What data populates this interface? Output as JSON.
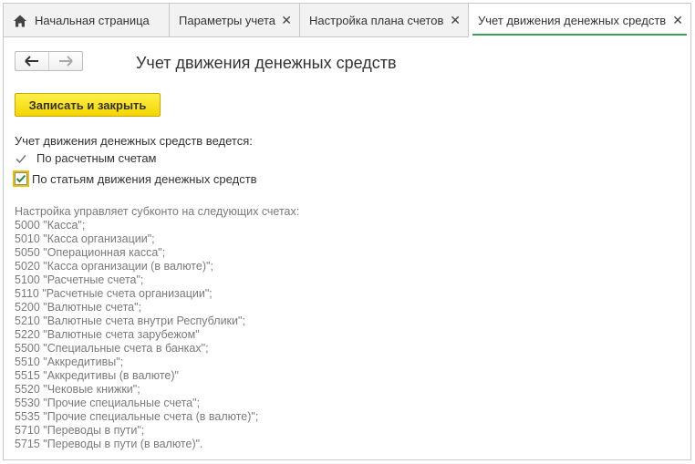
{
  "tabs": {
    "home": "Начальная страница",
    "params": "Параметры учета",
    "plan": "Настройка плана счетов",
    "cash": "Учет движения денежных средств"
  },
  "form": {
    "title": "Учет движения денежных средств",
    "save_label": "Записать и закрыть",
    "intro": "Учет движения денежных средств ведется:",
    "by_accounts": "По расчетным счетам",
    "by_items": "По статьям движения денежных средств",
    "by_items_checked": true
  },
  "accounts": {
    "header": "Настройка управляет субконто на следующих счетах:",
    "lines": [
      "5000 \"Касса\";",
      "5010 \"Касса организации\";",
      "5050 \"Операционная касса\";",
      "5020 \"Касса организации (в валюте)\";",
      "5100 \"Расчетные счета\";",
      "5110 \"Расчетные счета организации\";",
      "5200 \"Валютные счета\";",
      "5210 \"Валютные счета внутри Республики\";",
      "5220 \"Валютные счета зарубежом\"",
      "5500 \"Специальные счета в банках\";",
      "5510 \"Аккредитивы\";",
      "5515 \"Аккредитивы (в валюте)\"",
      "5520 \"Чековые книжки\";",
      "5530 \"Прочие специальные счета\";",
      "5535 \"Прочие специальные счета (в валюте)\";",
      "5710 \"Переводы в пути\";",
      "5715 \"Переводы в пути (в валюте)\"."
    ]
  },
  "colors": {
    "accent_yellow": "#f4d500",
    "active_tab_underline": "#3aa35b",
    "checkmark_green": "#2e8b3e"
  }
}
